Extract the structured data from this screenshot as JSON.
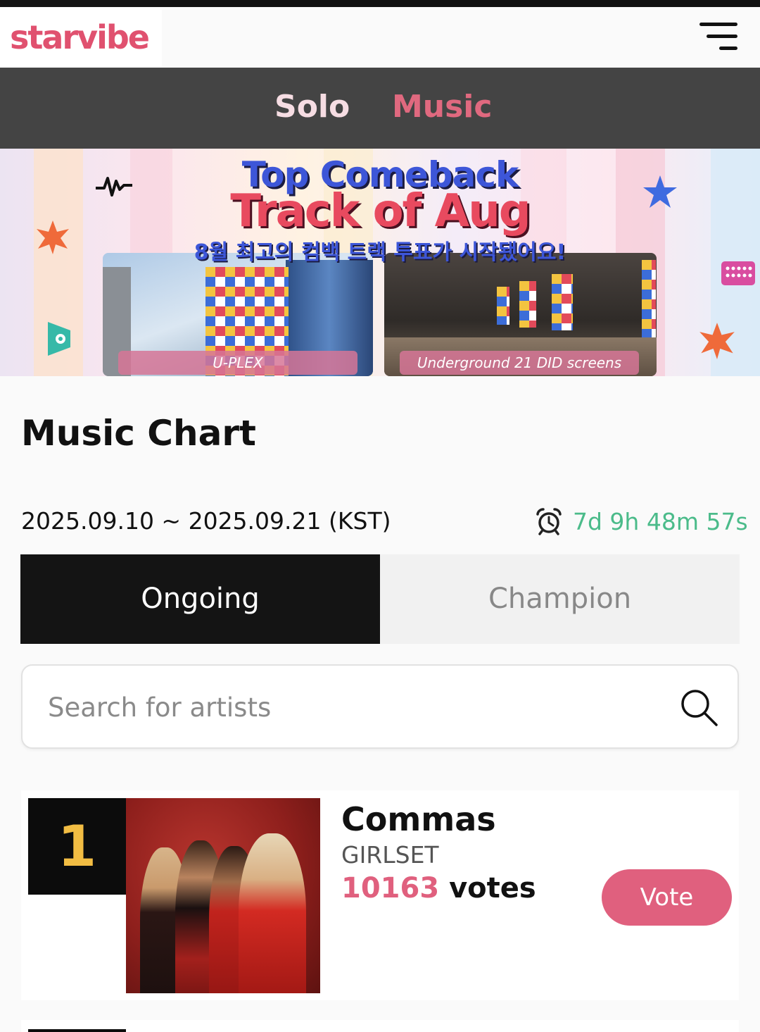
{
  "header": {
    "logo": "starvibe",
    "menu_icon": "hamburger-menu-icon"
  },
  "category_nav": {
    "tabs": [
      {
        "label": "Solo",
        "active": false
      },
      {
        "label": "Music",
        "active": true
      }
    ]
  },
  "banner": {
    "title_line1": "Top Comeback",
    "title_line2": "Track of Aug",
    "subtitle": "8월 최고의 컴백 트랙 투표가 시작됐어요!",
    "photos": [
      {
        "caption": "U-PLEX"
      },
      {
        "caption": "Underground 21 DID screens"
      }
    ]
  },
  "section": {
    "title": "Music Chart",
    "date_range": "2025.09.10 ~ 2025.09.21 (KST)",
    "timer_icon": "alarm-clock-icon",
    "countdown": "7d 9h 48m 57s"
  },
  "tabs": [
    {
      "label": "Ongoing",
      "active": true
    },
    {
      "label": "Champion",
      "active": false
    }
  ],
  "search": {
    "placeholder": "Search for artists",
    "value": "",
    "icon": "search-icon"
  },
  "chart": [
    {
      "rank": "1",
      "title": "Commas",
      "artist": "GIRLSET",
      "votes": "10163",
      "votes_suffix": " votes",
      "button": "Vote"
    }
  ],
  "colors": {
    "accent_pink": "#e0607e",
    "countdown_green": "#4bbb8a",
    "rank_gold": "#f2bd43",
    "nav_bg": "#444444"
  }
}
